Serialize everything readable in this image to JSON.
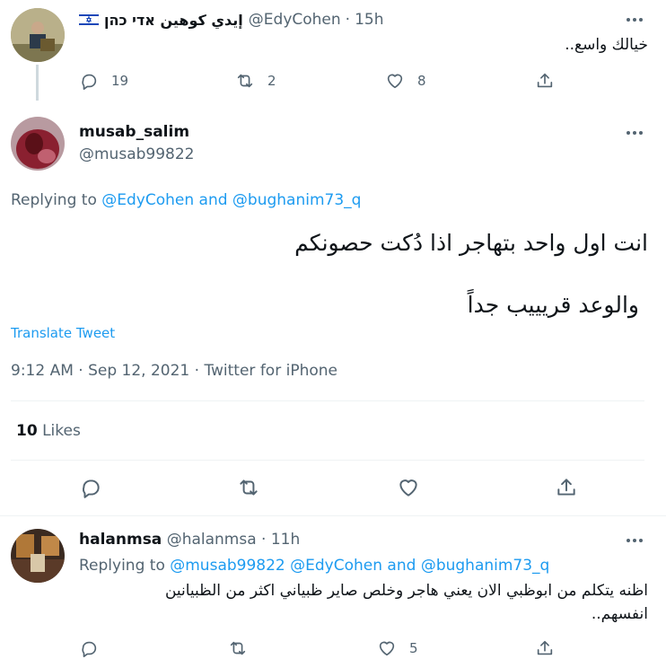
{
  "tweet1": {
    "display_name": "إيدي كوهين אדי כהן",
    "handle": "@EdyCohen",
    "time": "15h",
    "flag_icon": "israel-flag-icon",
    "text": "خيالك واسع..",
    "replies": "19",
    "retweets": "2",
    "likes": "8"
  },
  "main_tweet": {
    "display_name": "musab_salim",
    "handle": "@musab99822",
    "replying_prefix": "Replying to",
    "reply_user1": "@EdyCohen",
    "reply_and": "and",
    "reply_user2": "@bughanim73_q",
    "line1": "انت اول واحد بتهاجر اذا دُكت حصونكم",
    "line2": "والوعد قريييب جداً",
    "translate": "Translate Tweet",
    "meta": "9:12 AM · Sep 12, 2021 · Twitter for iPhone",
    "likes_count": "10",
    "likes_label": "Likes"
  },
  "reply": {
    "display_name": "halanmsa",
    "handle": "@halanmsa",
    "time": "11h",
    "replying_prefix": "Replying to",
    "reply_users": "@musab99822 @EdyCohen",
    "reply_and": "and",
    "reply_user3": "@bughanim73_q",
    "line1": "اظنه يتكلم من ابوظبي الان يعني هاجر وخلص صاير ظبياني اكثر من الظبيانين",
    "line2": "انفسهم..",
    "likes": "5"
  },
  "colors": {
    "accent": "#1d9bf0",
    "text": "#0f1419",
    "secondary": "#536471",
    "divider": "#eff3f4"
  }
}
